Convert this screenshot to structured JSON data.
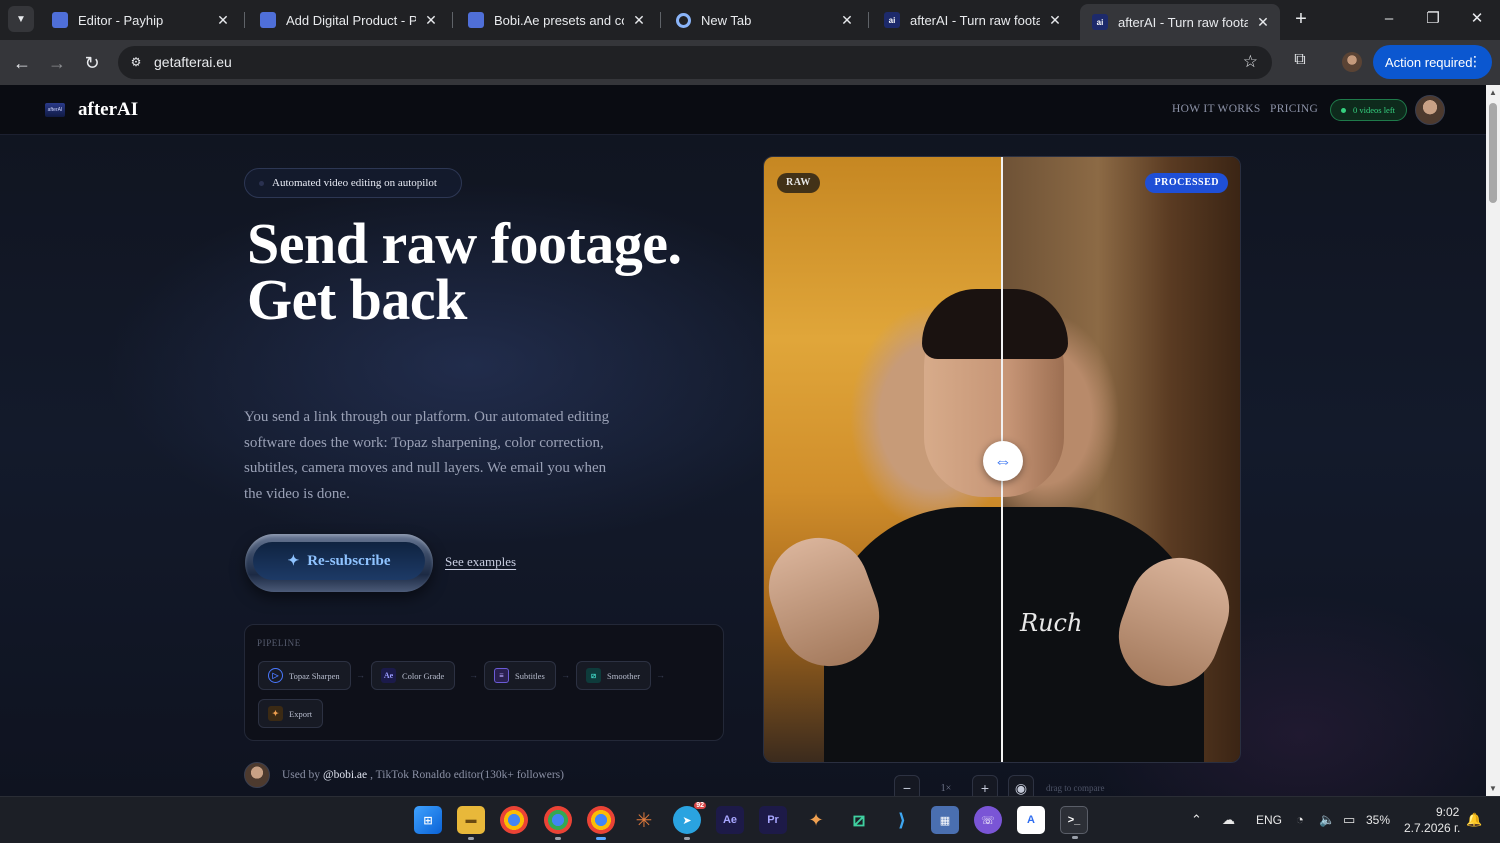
{
  "browser": {
    "tabs": [
      {
        "title": "Editor - Payhip",
        "favicon": "payhip-icon"
      },
      {
        "title": "Add Digital Product - Payhip",
        "favicon": "payhip-icon"
      },
      {
        "title": "Bobi.Ae presets and compositions",
        "favicon": "payhip-icon"
      },
      {
        "title": "New Tab",
        "favicon": "chrome-icon"
      },
      {
        "title": "afterAI - Turn raw footage",
        "favicon": "afterai-icon"
      },
      {
        "title": "afterAI - Turn raw footage",
        "favicon": "afterai-icon",
        "active": true
      }
    ],
    "url": "getafterai.eu",
    "action_required": "Action required"
  },
  "site": {
    "logo_mark": "afterAI",
    "logo_text": "afterAI",
    "nav": [
      "HOW IT WORKS",
      "PRICING"
    ],
    "videos_left": "0 videos left",
    "badge": "Automated video editing on autopilot",
    "hero_line1": "Send raw footage.",
    "hero_line2": "Get back",
    "description": "You send a link through our platform. Our automated editing software does the work: Topaz sharpening, color correction, subtitles, camera moves and null layers. We email you when the video is done.",
    "primary_cta": "Re-subscribe",
    "secondary_cta": "See examples",
    "pipeline": {
      "title": "PIPELINE",
      "steps": [
        {
          "label": "Topaz Sharpen",
          "icon": "topaz-icon",
          "glyph": "▷"
        },
        {
          "label": "Color Grade",
          "icon": "after-effects-icon",
          "glyph": "Ae"
        },
        {
          "label": "Subtitles",
          "icon": "subtitles-icon",
          "glyph": "≡"
        },
        {
          "label": "Smoother",
          "icon": "smoother-icon",
          "glyph": "⧄"
        },
        {
          "label": "Export",
          "icon": "export-icon",
          "glyph": "✦"
        }
      ]
    },
    "used_by_prefix": "Used by",
    "used_by_handle": "@bobi.ae",
    "used_by_suffix": ", TikTok Ronaldo editor(130k+ followers)",
    "compare": {
      "raw_label": "RAW",
      "processed_label": "PROCESSED",
      "shirt_text": "Ruch",
      "split_fraction": 0.5
    },
    "zoom": {
      "value": "1×",
      "minus": "−",
      "plus": "+",
      "hint": "drag to compare"
    }
  },
  "taskbar": {
    "apps": [
      "windows-start-icon",
      "file-explorer-icon",
      "chrome-icon",
      "chrome-profile-icon",
      "chrome-active-icon",
      "claude-icon",
      "telegram-icon",
      "after-effects-icon",
      "premiere-icon",
      "game-icon",
      "smoother-app-icon",
      "vscode-icon",
      "calculator-icon",
      "viber-icon",
      "arc-icon",
      "terminal-icon"
    ],
    "telegram_badge": "92",
    "language": "ENG",
    "battery": "35%",
    "time": "9:02",
    "date": "2.7.2026 г."
  },
  "colors": {
    "accent": "#1f4fd6",
    "action_button": "#0b57d0",
    "status_green": "#35d07f"
  }
}
